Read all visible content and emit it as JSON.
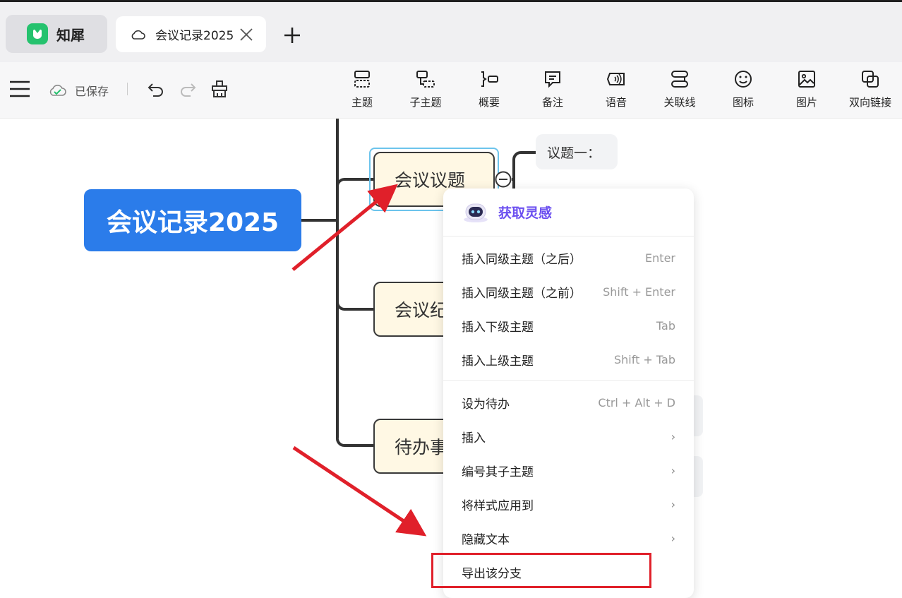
{
  "app": {
    "name": "知犀",
    "brand_color": "#25c26e"
  },
  "tabs": {
    "document_title": "会议记录2025",
    "close_icon": "close-icon",
    "new_tab_icon": "plus-icon"
  },
  "toolbar": {
    "saved_status": "已保存",
    "tools": [
      {
        "label": "主题",
        "icon": "topic-icon"
      },
      {
        "label": "子主题",
        "icon": "subtopic-icon"
      },
      {
        "label": "概要",
        "icon": "summary-icon"
      },
      {
        "label": "备注",
        "icon": "note-icon"
      },
      {
        "label": "语音",
        "icon": "voice-icon"
      },
      {
        "label": "关联线",
        "icon": "relation-line-icon"
      },
      {
        "label": "图标",
        "icon": "emoji-icon"
      },
      {
        "label": "图片",
        "icon": "image-icon"
      },
      {
        "label": "双向链接",
        "icon": "bidirectional-link-icon"
      }
    ]
  },
  "mindmap": {
    "root": "会议记录2025",
    "topics": [
      {
        "label": "会议议题"
      },
      {
        "label": "会议纪要"
      },
      {
        "label": "待办事项"
      }
    ],
    "subtopic": "议题一："
  },
  "context_menu": {
    "ai_label": "获取灵感",
    "items": [
      {
        "label": "插入同级主题（之后）",
        "shortcut": "Enter"
      },
      {
        "label": "插入同级主题（之前）",
        "shortcut": "Shift + Enter"
      },
      {
        "label": "插入下级主题",
        "shortcut": "Tab"
      },
      {
        "label": "插入上级主题",
        "shortcut": "Shift + Tab"
      },
      {
        "label": "设为待办",
        "shortcut": "Ctrl + Alt + D"
      },
      {
        "label": "插入",
        "shortcut": "›"
      },
      {
        "label": "编号其子主题",
        "shortcut": "›"
      },
      {
        "label": "将样式应用到",
        "shortcut": "›"
      },
      {
        "label": "隐藏文本",
        "shortcut": "›"
      },
      {
        "label": "导出该分支",
        "shortcut": ""
      }
    ]
  },
  "colors": {
    "root_fill": "#2b7cea",
    "topic_fill": "#fff8e4",
    "selection_ring": "#6cc4ec",
    "ai_accent": "#6b4ff0",
    "annotation_red": "#e0202a"
  }
}
